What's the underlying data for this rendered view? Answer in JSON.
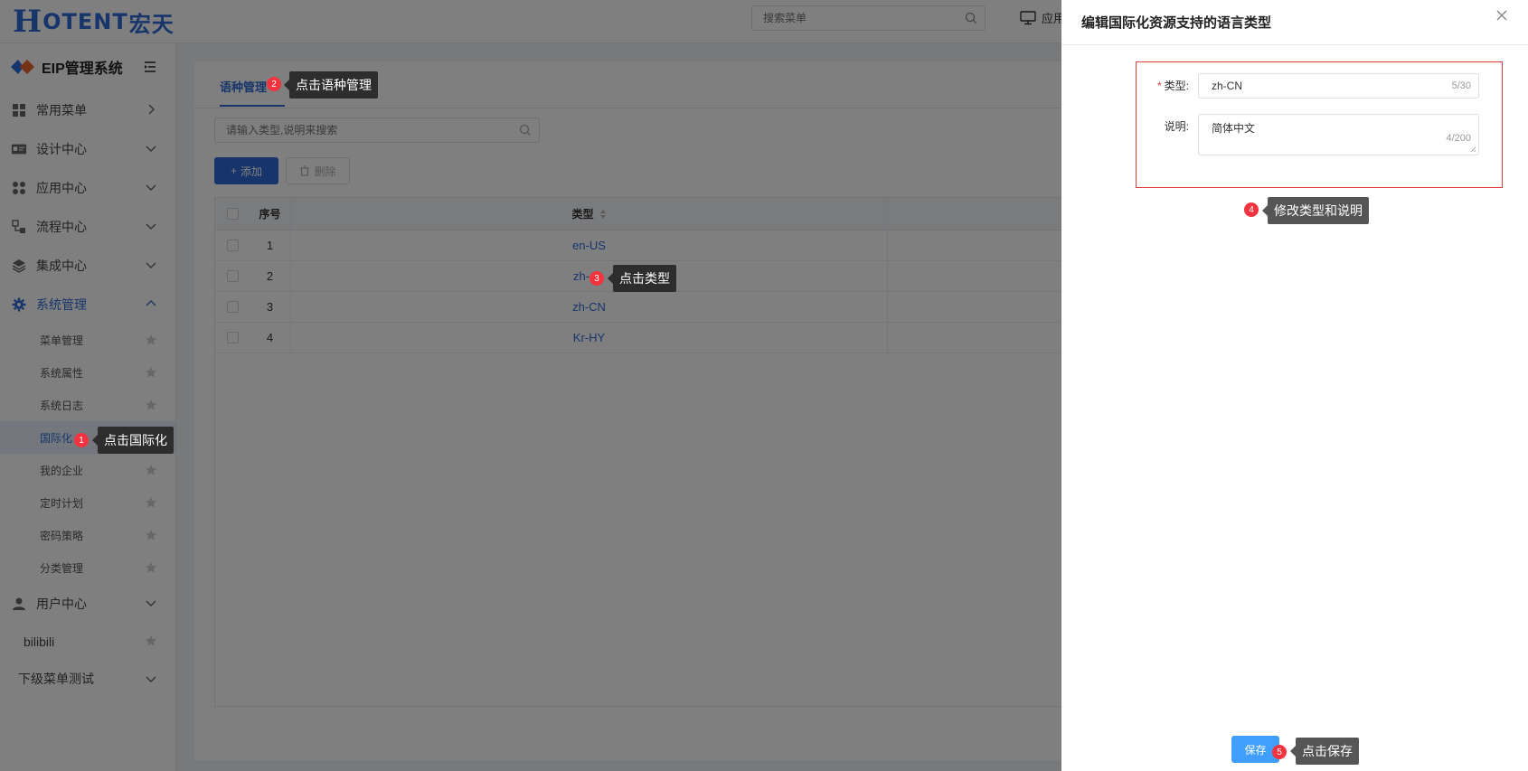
{
  "header": {
    "logo_h": "H",
    "logo_text": "OTENT",
    "logo_cn": "宏天",
    "search_placeholder": "搜索菜单",
    "monitor_label": "应用"
  },
  "sidebar": {
    "brand": "EIP管理系统",
    "menus": [
      {
        "label": "常用菜单",
        "icon": "grid-icon"
      },
      {
        "label": "设计中心",
        "icon": "id-card-icon"
      },
      {
        "label": "应用中心",
        "icon": "apps-icon"
      },
      {
        "label": "流程中心",
        "icon": "flow-icon"
      },
      {
        "label": "集成中心",
        "icon": "layers-icon"
      },
      {
        "label": "系统管理",
        "icon": "gear-icon"
      }
    ],
    "sub_items": [
      "菜单管理",
      "系统属性",
      "系统日志",
      "国际化",
      "我的企业",
      "定时计划",
      "密码策略",
      "分类管理"
    ],
    "user_center": "用户中心",
    "bilibili": "bilibili",
    "sub_menu_test": "下级菜单测试"
  },
  "main": {
    "tab": "语种管理",
    "search_placeholder": "请输入类型,说明来搜索",
    "add_label": "添加",
    "delete_label": "删除",
    "columns": {
      "index": "序号",
      "type": "类型"
    },
    "rows": [
      {
        "index": "1",
        "type": "en-US"
      },
      {
        "index": "2",
        "type": "zh-"
      },
      {
        "index": "3",
        "type": "zh-CN"
      },
      {
        "index": "4",
        "type": "Kr-HY"
      }
    ]
  },
  "drawer": {
    "title": "编辑国际化资源支持的语言类型",
    "type_label": "类型:",
    "type_value": "zh-CN",
    "type_count": "5/30",
    "desc_label": "说明:",
    "desc_value": "简体中文",
    "desc_count": "4/200",
    "save_label": "保存"
  },
  "steps": [
    {
      "num": "1",
      "text": "点击国际化"
    },
    {
      "num": "2",
      "text": "点击语种管理"
    },
    {
      "num": "3",
      "text": "点击类型"
    },
    {
      "num": "4",
      "text": "修改类型和说明"
    },
    {
      "num": "5",
      "text": "点击保存"
    }
  ],
  "colors": {
    "primary": "#2f6bd6",
    "save": "#409eff",
    "step": "#f5333f",
    "highlight": "#e23b3b"
  }
}
